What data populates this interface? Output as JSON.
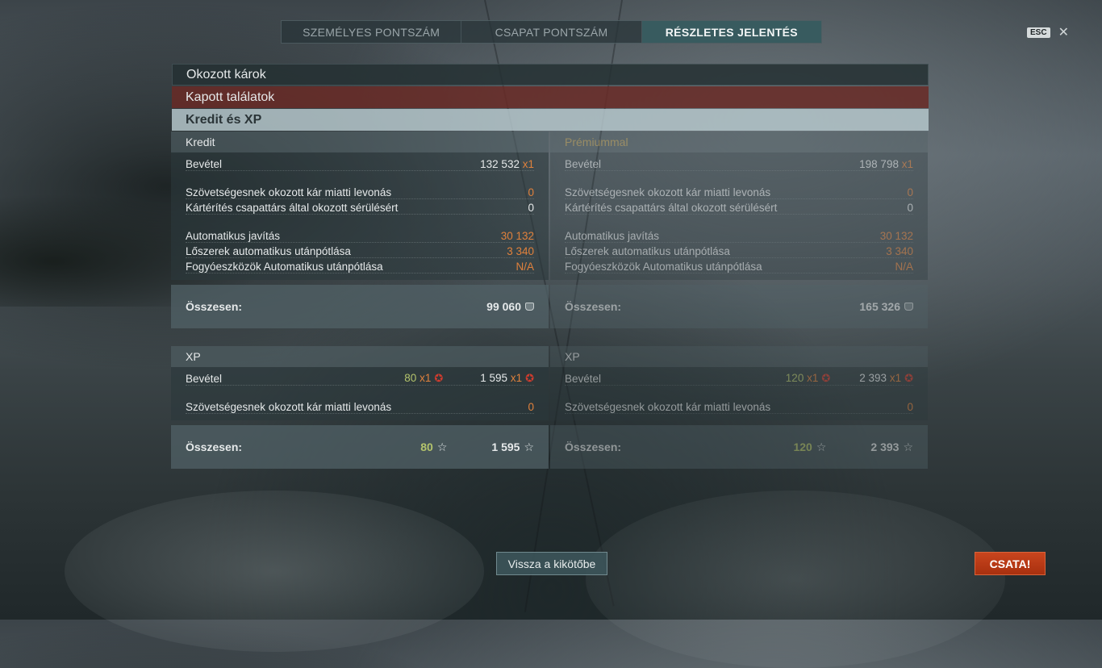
{
  "tabs": [
    {
      "label": "SZEMÉLYES PONTSZÁM",
      "active": false
    },
    {
      "label": "CSAPAT PONTSZÁM",
      "active": false
    },
    {
      "label": "RÉSZLETES JELENTÉS",
      "active": true
    }
  ],
  "esc": {
    "key": "ESC",
    "close": "✕"
  },
  "sections": {
    "damage": "Okozott károk",
    "hits": "Kapott találatok",
    "credit_xp": "Kredit és XP"
  },
  "credit": {
    "title": "Kredit",
    "income_label": "Bevétel",
    "income_value": "132 532",
    "income_mult": "x1",
    "ally_damage_label": "Szövetségesnek okozott kár miatti levonás",
    "ally_damage_value": "0",
    "compensation_label": "Kártérítés csapattárs által okozott sérülésért",
    "compensation_value": "0",
    "repair_label": "Automatikus javítás",
    "repair_value": "30 132",
    "ammo_label": "Lőszerek automatikus utánpótlása",
    "ammo_value": "3 340",
    "consumables_label": "Fogyóeszközök Automatikus utánpótlása",
    "consumables_value": "N/A",
    "total_label": "Összesen:",
    "total_value": "99 060"
  },
  "premium": {
    "title": "Prémiummal",
    "income_label": "Bevétel",
    "income_value": "198 798",
    "income_mult": "x1",
    "ally_damage_label": "Szövetségesnek okozott kár miatti levonás",
    "ally_damage_value": "0",
    "compensation_label": "Kártérítés csapattárs által okozott sérülésért",
    "compensation_value": "0",
    "repair_label": "Automatikus javítás",
    "repair_value": "30 132",
    "ammo_label": "Lőszerek automatikus utánpótlása",
    "ammo_value": "3 340",
    "consumables_label": "Fogyóeszközök Automatikus utánpótlása",
    "consumables_value": "N/A",
    "total_label": "Összesen:",
    "total_value": "165 326"
  },
  "xp": {
    "title": "XP",
    "income_label": "Bevétel",
    "xp_value": "80",
    "xp_mult": "x1",
    "free_value": "1 595",
    "free_mult": "x1",
    "ally_damage_label": "Szövetségesnek okozott kár miatti levonás",
    "ally_damage_value": "0",
    "total_label": "Összesen:",
    "total_xp": "80",
    "total_free": "1 595"
  },
  "xp_premium": {
    "title": "XP",
    "income_label": "Bevétel",
    "xp_value": "120",
    "xp_mult": "x1",
    "free_value": "2 393",
    "free_mult": "x1",
    "ally_damage_label": "Szövetségesnek okozott kár miatti levonás",
    "ally_damage_value": "0",
    "total_label": "Összesen:",
    "total_xp": "120",
    "total_free": "2 393"
  },
  "icons": {
    "credit": "credit-coin-icon",
    "xp": "star-icon",
    "premium_xp": "red-star-icon"
  },
  "colors": {
    "accent_orange": "#e0813c",
    "xp_green": "#b4c46c",
    "battle_red": "#b83a16",
    "active_tab": "#3a6064"
  },
  "buttons": {
    "back": "Vissza a kikötőbe",
    "battle": "CSATA!"
  }
}
